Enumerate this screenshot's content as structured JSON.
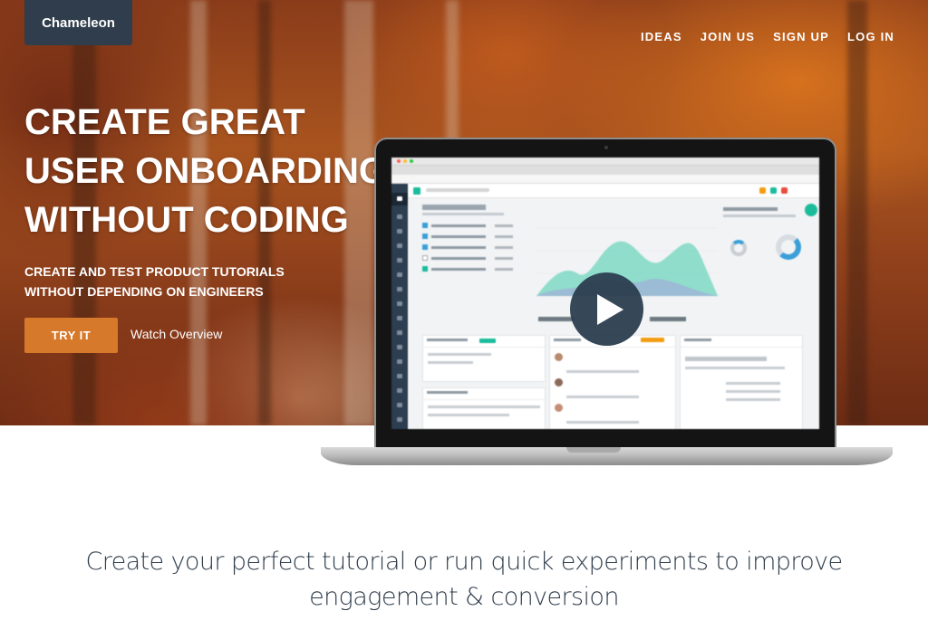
{
  "brand": {
    "name": "Chameleon"
  },
  "nav": {
    "items": [
      "IDEAS",
      "JOIN US",
      "SIGN UP",
      "LOG IN"
    ]
  },
  "hero": {
    "headline": [
      "CREATE GREAT",
      "USER ONBOARDING",
      "WITHOUT CODING"
    ],
    "subheadline": [
      "CREATE AND TEST PRODUCT TUTORIALS",
      "WITHOUT DEPENDING ON ENGINEERS"
    ],
    "cta_label": "TRY IT",
    "watch_label": "Watch Overview"
  },
  "tagline": [
    "Create your perfect tutorial or run quick experiments to improve",
    "engagement & conversion"
  ],
  "colors": {
    "logo_bg": "#2f3d4c",
    "cta_bg": "#d7792a",
    "play_bg": "#2c3e50",
    "text_dark": "#2f3d4c",
    "accent_teal": "#1abc9c"
  },
  "icons": [
    "play-icon"
  ]
}
